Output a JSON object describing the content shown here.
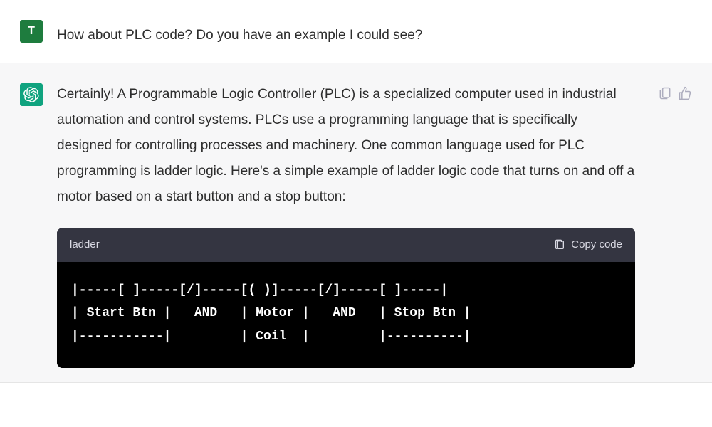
{
  "user": {
    "avatar_letter": "T",
    "message": "How about PLC code? Do you have an example I could see?"
  },
  "assistant": {
    "intro": "Certainly! A Programmable Logic Controller (PLC) is a specialized computer used in industrial automation and control systems. PLCs use a programming language that is specifically designed for controlling processes and machinery. One common language used for PLC programming is ladder logic. Here's a simple example of ladder logic code that turns on and off a motor based on a start button and a stop button:",
    "code": {
      "language": "ladder",
      "copy_label": "Copy code",
      "body": "|-----[ ]-----[/]-----[( )]-----[/]-----[ ]-----|\n| Start Btn |   AND   | Motor |   AND   | Stop Btn |\n|-----------|         | Coil  |         |----------|"
    }
  }
}
